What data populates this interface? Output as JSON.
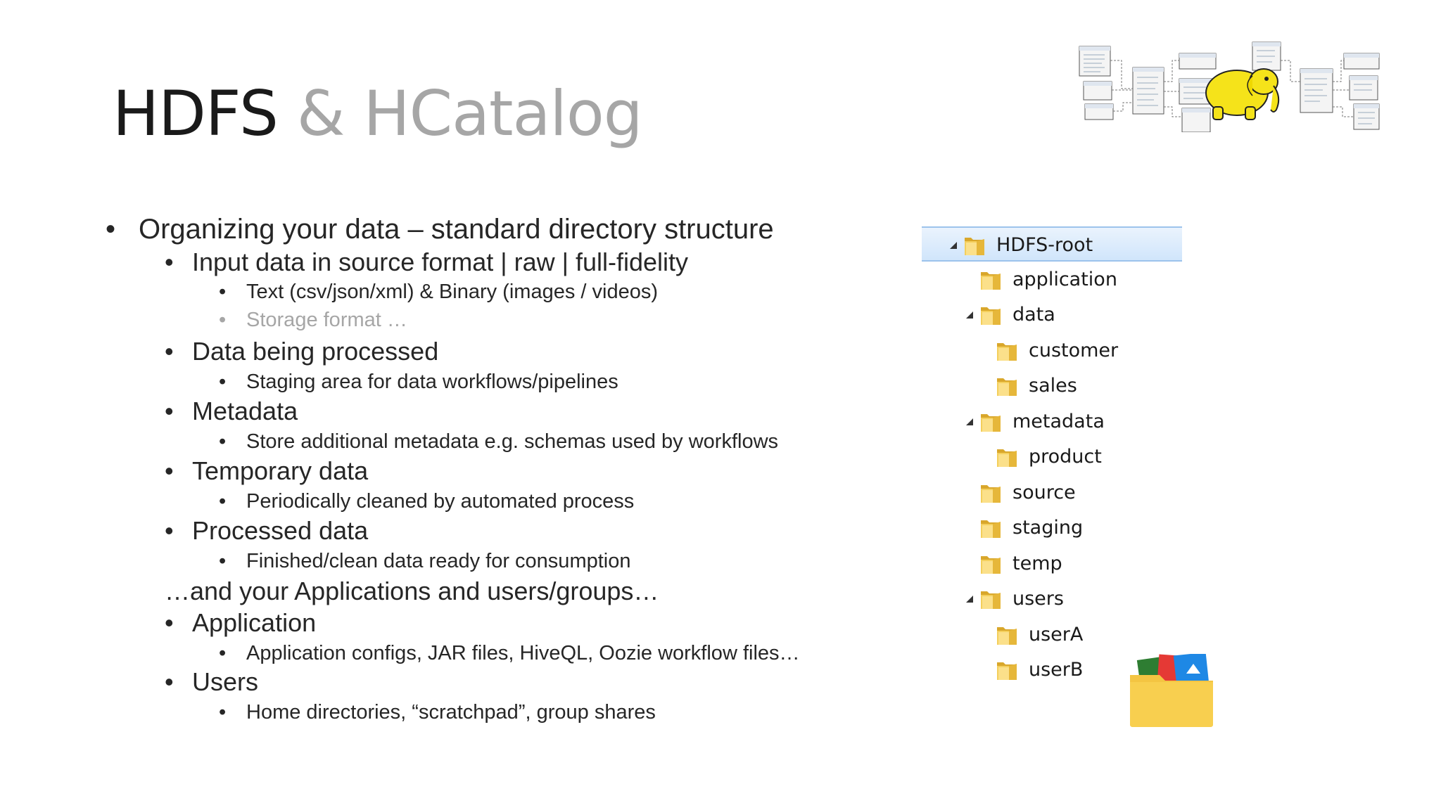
{
  "slide": {
    "title_main": "HDFS",
    "title_secondary": "& HCatalog"
  },
  "bullets": [
    {
      "level": 1,
      "text": "Organizing your data – standard directory structure"
    },
    {
      "level": 2,
      "text": "Input data in source format | raw | full-fidelity"
    },
    {
      "level": 3,
      "text": "Text (csv/json/xml) & Binary (images / videos)"
    },
    {
      "level": 3,
      "text": "Storage format …",
      "faded": true
    },
    {
      "level": 2,
      "text": "Data being processed"
    },
    {
      "level": 3,
      "text": "Staging area for data workflows/pipelines"
    },
    {
      "level": 2,
      "text": "Metadata"
    },
    {
      "level": 3,
      "text": "Store additional metadata e.g. schemas used by workflows"
    },
    {
      "level": 2,
      "text": "Temporary data"
    },
    {
      "level": 3,
      "text": "Periodically cleaned by automated process"
    },
    {
      "level": 2,
      "text": "Processed data"
    },
    {
      "level": 3,
      "text": "Finished/clean data ready for consumption"
    },
    {
      "level": "note",
      "text": "…and your Applications and users/groups…"
    },
    {
      "level": 2,
      "text": "Application"
    },
    {
      "level": 3,
      "text": "Application configs, JAR files, HiveQL, Oozie workflow files…"
    },
    {
      "level": 2,
      "text": "Users"
    },
    {
      "level": 3,
      "text": "Home directories, “scratchpad”, group shares"
    }
  ],
  "bullet_glyph": "•",
  "tree": {
    "items": [
      {
        "label": "HDFS-root",
        "depth": 0,
        "expanded": true,
        "selected": true
      },
      {
        "label": "application",
        "depth": 1
      },
      {
        "label": "data",
        "depth": 1,
        "expanded": true
      },
      {
        "label": "customer",
        "depth": 2
      },
      {
        "label": "sales",
        "depth": 2
      },
      {
        "label": "metadata",
        "depth": 1,
        "expanded": true
      },
      {
        "label": "product",
        "depth": 2
      },
      {
        "label": "source",
        "depth": 1
      },
      {
        "label": "staging",
        "depth": 1
      },
      {
        "label": "temp",
        "depth": 1
      },
      {
        "label": "users",
        "depth": 1,
        "expanded": true
      },
      {
        "label": "userA",
        "depth": 2
      },
      {
        "label": "userB",
        "depth": 2
      }
    ]
  },
  "icons": {
    "tree_expand": "expanded-triangle-icon",
    "folder": "folder-icon",
    "diagram": "hadoop-elephant-schema-diagram",
    "decorative_folder": "open-folder-icon"
  },
  "colors": {
    "title_primary": "#1a1a1a",
    "title_secondary": "#a6a6a6",
    "text": "#262626",
    "faded_text": "#a6a6a6",
    "selection_bg": "#d0e5fb",
    "selection_border": "#9cc3ec",
    "folder": "#f4c542",
    "elephant": "#f5e31a"
  }
}
